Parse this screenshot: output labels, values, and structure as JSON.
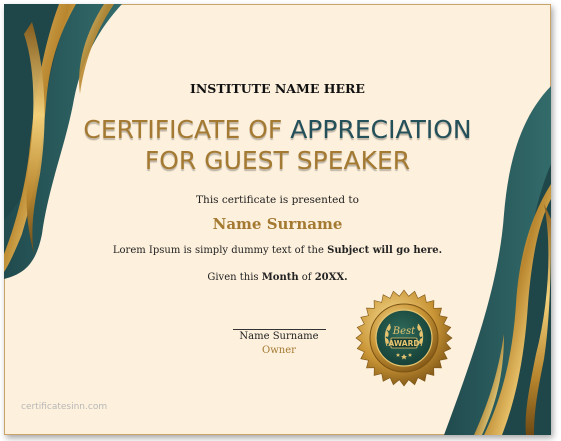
{
  "institute": "INSTITUTE NAME HERE",
  "title_line1_a": "CERTIFICATE OF ",
  "title_line1_b": "APPRECIATION",
  "title_line2": "FOR GUEST SPEAKER",
  "presented_to": "This certificate is presented to",
  "recipient_name": "Name Surname",
  "lorem_prefix": "Lorem Ipsum is simply dummy text of the ",
  "lorem_bold": "Subject will go here.",
  "given_prefix": "Given this ",
  "given_month": "Month",
  "given_of": " of ",
  "given_year": "20XX.",
  "signature": {
    "name": "Name Surname",
    "role": "Owner"
  },
  "seal": {
    "top_text": "Best",
    "bottom_text": "AWARD"
  },
  "watermark": "certificatesinn.com",
  "colors": {
    "background": "#fdf0dc",
    "teal": "#2a5a5c",
    "gold": "#a47a32"
  }
}
